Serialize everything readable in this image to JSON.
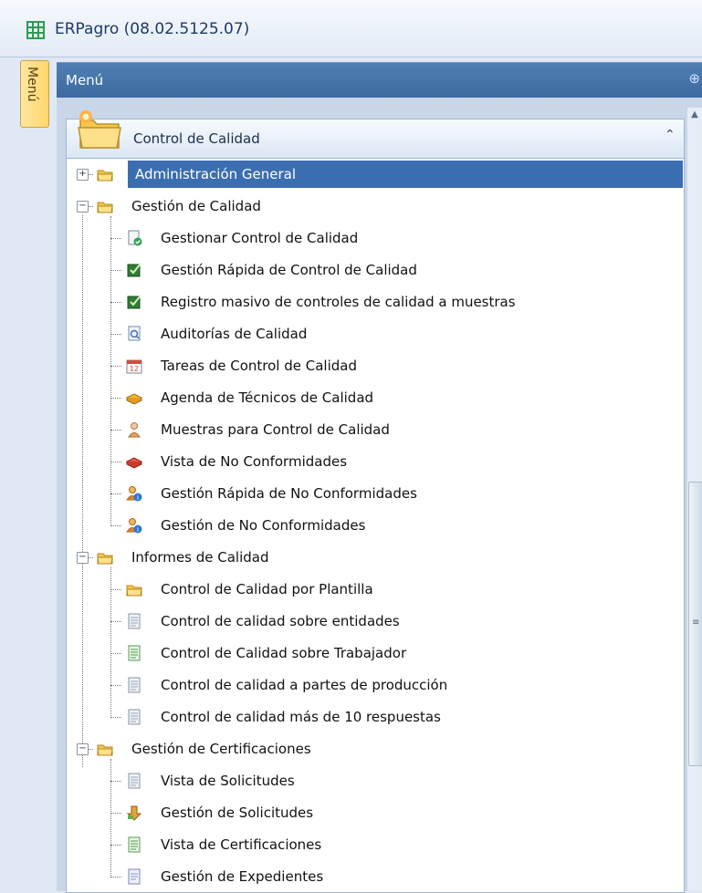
{
  "window": {
    "title": "ERPagro (08.02.5125.07)",
    "app_icon": "grid-app-icon"
  },
  "side_tab": {
    "label": "Menú"
  },
  "menu_panel": {
    "header": "Menú",
    "pin_icon": "pin-icon"
  },
  "group": {
    "title": "Control de Calidad",
    "icon": "folder-star-icon",
    "collapse_icon": "double-chevron-up-icon"
  },
  "tree": {
    "selected": "Administración General",
    "nodes": [
      {
        "label": "Administración General",
        "level": 0,
        "expander": "+",
        "icon": "folder-icon"
      },
      {
        "label": "Gestión de Calidad",
        "level": 0,
        "expander": "-",
        "icon": "folder-icon"
      },
      {
        "label": "Gestionar Control de Calidad",
        "level": 1,
        "icon": "document-check-icon"
      },
      {
        "label": "Gestión Rápida de Control de Calidad",
        "level": 1,
        "icon": "edit-checkbox-icon"
      },
      {
        "label": "Registro masivo de controles de calidad a muestras",
        "level": 1,
        "icon": "edit-checkbox-icon"
      },
      {
        "label": "Auditorías de Calidad",
        "level": 1,
        "icon": "document-search-icon"
      },
      {
        "label": "Tareas de Control de Calidad",
        "level": 1,
        "icon": "calendar-12-icon"
      },
      {
        "label": "Agenda de Técnicos de Calidad",
        "level": 1,
        "icon": "book-icon"
      },
      {
        "label": "Muestras para Control de Calidad",
        "level": 1,
        "icon": "user-icon"
      },
      {
        "label": "Vista de No Conformidades",
        "level": 1,
        "icon": "red-book-icon"
      },
      {
        "label": "Gestión Rápida de No Conformidades",
        "level": 1,
        "icon": "user-info-icon"
      },
      {
        "label": "Gestión de No Conformidades",
        "level": 1,
        "icon": "user-info-icon"
      },
      {
        "label": "Informes de Calidad",
        "level": 0,
        "expander": "-",
        "icon": "folder-icon"
      },
      {
        "label": "Control de Calidad por Plantilla",
        "level": 1,
        "icon": "folder-icon"
      },
      {
        "label": "Control de calidad sobre entidades",
        "level": 1,
        "icon": "report-icon"
      },
      {
        "label": "Control de Calidad sobre Trabajador",
        "level": 1,
        "icon": "report-green-icon"
      },
      {
        "label": "Control de calidad a partes de producción",
        "level": 1,
        "icon": "report-icon"
      },
      {
        "label": "Control de calidad más de 10 respuestas",
        "level": 1,
        "icon": "report-icon"
      },
      {
        "label": "Gestión de Certificaciones",
        "level": 0,
        "expander": "-",
        "icon": "folder-icon"
      },
      {
        "label": "Vista de Solicitudes",
        "level": 1,
        "icon": "report-icon"
      },
      {
        "label": "Gestión de Solicitudes",
        "level": 1,
        "icon": "hand-down-icon"
      },
      {
        "label": "Vista de Certificaciones",
        "level": 1,
        "icon": "report-green-icon"
      },
      {
        "label": "Gestión de Expedientes",
        "level": 1,
        "icon": "folder-doc-icon"
      }
    ]
  },
  "colors": {
    "accent": "#3b6eb1",
    "header": "#4a79ae",
    "side_tab": "#ffd66b"
  }
}
